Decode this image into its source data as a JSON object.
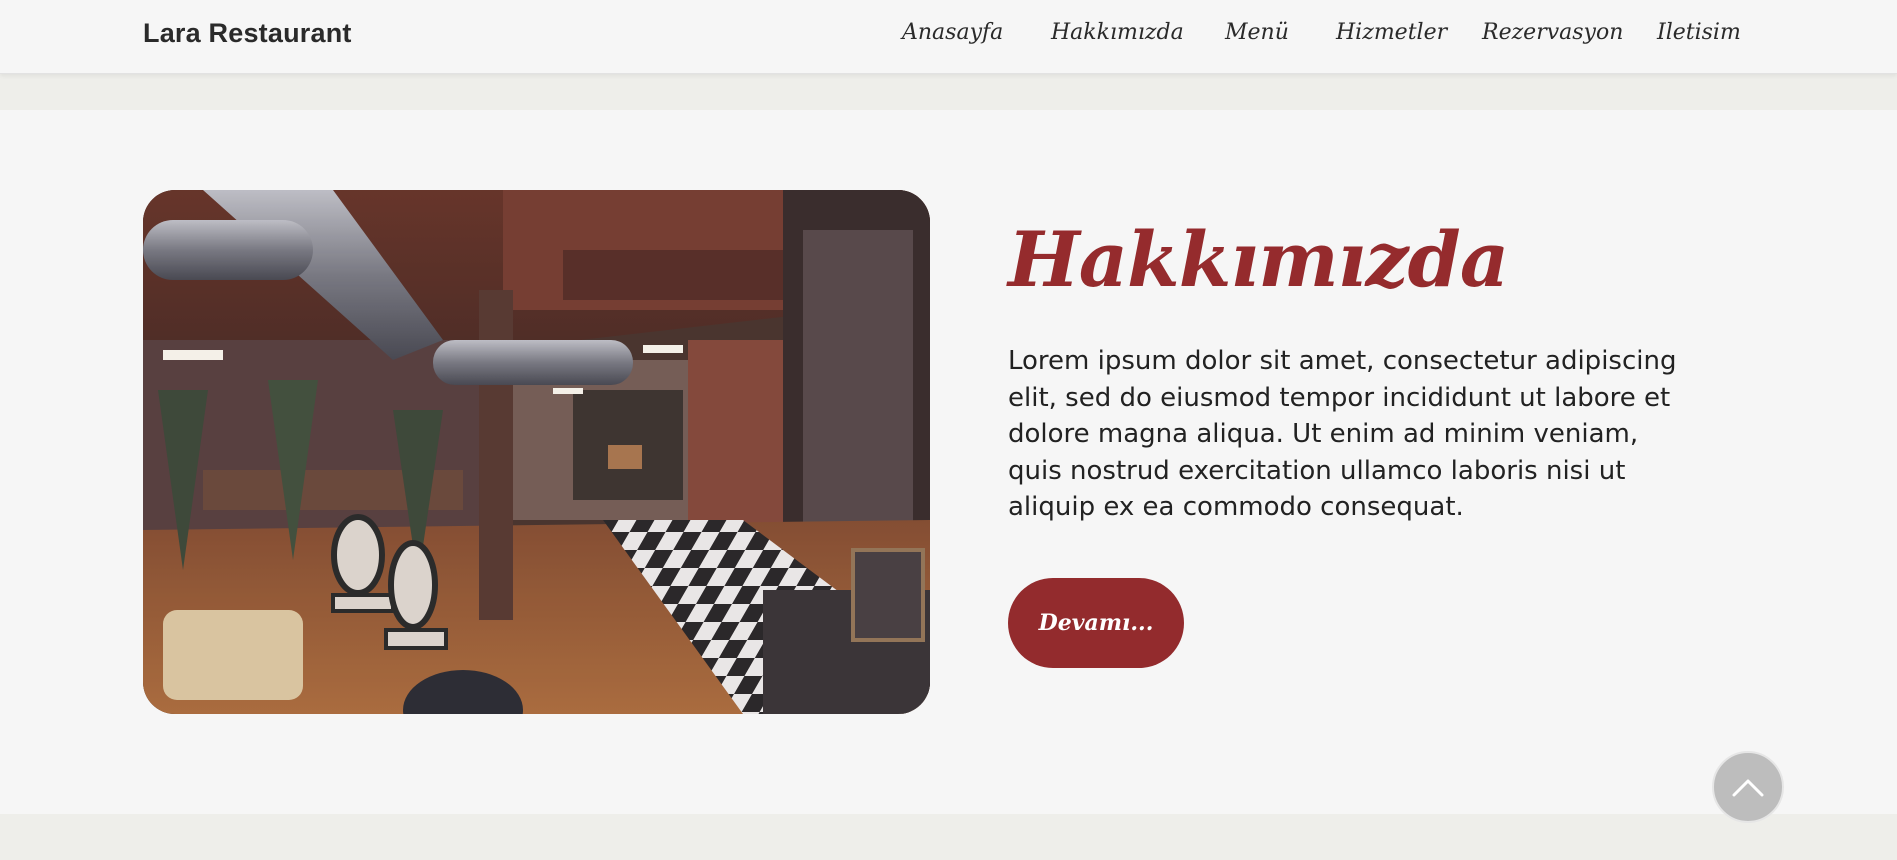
{
  "header": {
    "brand": "Lara Restaurant",
    "nav": [
      {
        "label": "Anasayfa"
      },
      {
        "label": "Hakkımızda"
      },
      {
        "label": "Menü"
      },
      {
        "label": "Hizmetler"
      },
      {
        "label": "Rezervasyon"
      },
      {
        "label": "Iletisim"
      }
    ]
  },
  "about": {
    "title": "Hakkımızda",
    "text": "Lorem ipsum dolor sit amet, consectetur adipiscing elit, sed do eiusmod tempor incididunt ut labore et dolore magna aliqua. Ut enim ad minim veniam, quis nostrud exercitation ullamco laboris nisi ut aliquip ex ea commodo consequat.",
    "button_label": "Devamı...",
    "image_alt": "restaurant-interior-photo"
  },
  "scroll_top": {
    "icon": "chevron-up-icon"
  },
  "colors": {
    "accent": "#952b2d",
    "header_bg": "#f6f6f6",
    "section_bg": "#f6f6f6",
    "page_bg": "#eeeeea",
    "text": "#222222"
  }
}
